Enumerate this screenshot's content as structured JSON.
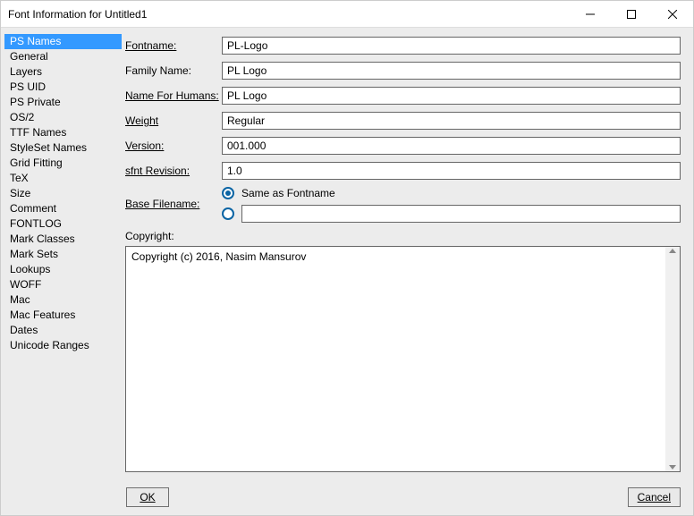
{
  "window": {
    "title": "Font Information for Untitled1"
  },
  "sidebar": {
    "items": [
      "PS Names",
      "General",
      "Layers",
      "PS UID",
      "PS Private",
      "OS/2",
      "TTF Names",
      "StyleSet Names",
      "Grid Fitting",
      "TeX",
      "Size",
      "Comment",
      "FONTLOG",
      "Mark Classes",
      "Mark Sets",
      "Lookups",
      "WOFF",
      "Mac",
      "Mac Features",
      "Dates",
      "Unicode Ranges"
    ],
    "selectedIndex": 0
  },
  "form": {
    "fontname_label": "Fontname:",
    "fontname_value": "PL-Logo",
    "family_label": "Family Name:",
    "family_value": "PL Logo",
    "humans_label": "Name For Humans:",
    "humans_value": "PL Logo",
    "weight_label": "Weight",
    "weight_value": "Regular",
    "version_label": "Version:",
    "version_value": "001.000",
    "sfnt_label": "sfnt Revision:",
    "sfnt_value": "1.0",
    "base_label": "Base Filename:",
    "base_same_label": "Same as Fontname",
    "base_custom_value": "",
    "copyright_label": "Copyright:",
    "copyright_value": "Copyright (c) 2016, Nasim Mansurov"
  },
  "buttons": {
    "ok": "OK",
    "cancel": "Cancel"
  }
}
